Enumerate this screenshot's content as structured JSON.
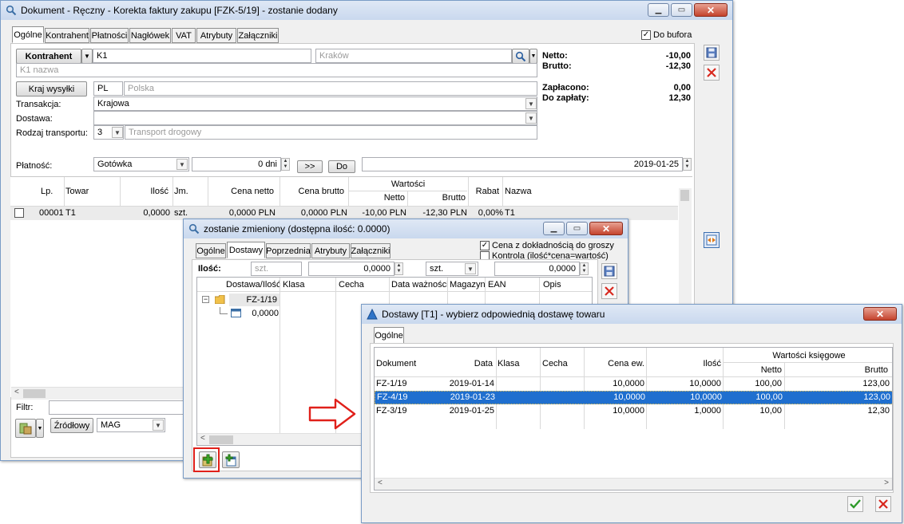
{
  "main": {
    "title": "Dokument - Ręczny - Korekta faktury zakupu [FZK-5/19]  - zostanie dodany",
    "tabs": [
      "Ogólne",
      "Kontrahent",
      "Płatności",
      "Nagłówek",
      "VAT",
      "Atrybuty",
      "Załączniki"
    ],
    "do_bufora": "Do bufora",
    "kontrahent_btn": "Kontrahent",
    "kontrahent_code": "K1",
    "kontrahent_city": "Kraków",
    "kontrahent_name": "K1 nazwa",
    "kraj_btn": "Kraj wysyłki",
    "kraj_code": "PL",
    "kraj_name": "Polska",
    "transakcja_label": "Transakcja:",
    "transakcja_value": "Krajowa",
    "dostawa_label": "Dostawa:",
    "rodzaj_label": "Rodzaj transportu:",
    "rodzaj_code": "3",
    "rodzaj_value": "Transport drogowy",
    "platnosc_label": "Płatność:",
    "platnosc_value": "Gotówka",
    "dni_value": "0 dni",
    "btn_forward": ">>",
    "btn_do": "Do",
    "date_value": "2019-01-25",
    "totals": {
      "netto_label": "Netto:",
      "netto_value": "-10,00",
      "brutto_label": "Brutto:",
      "brutto_value": "-12,30",
      "zaplacono_label": "Zapłacono:",
      "zaplacono_value": "0,00",
      "dozaplaty_label": "Do zapłaty:",
      "dozaplaty_value": "12,30"
    },
    "grid": {
      "headers": {
        "lp": "Lp.",
        "towar": "Towar",
        "ilosc": "Ilość",
        "jm": "Jm.",
        "cena_netto": "Cena netto",
        "cena_brutto": "Cena brutto",
        "wartosci": "Wartości",
        "netto": "Netto",
        "brutto": "Brutto",
        "rabat": "Rabat",
        "nazwa": "Nazwa"
      },
      "row": {
        "lp": "00001",
        "towar": "T1",
        "ilosc": "0,0000",
        "jm": "szt.",
        "cena_netto": "0,0000 PLN",
        "cena_brutto": "0,0000 PLN",
        "netto": "-10,00 PLN",
        "brutto": "-12,30 PLN",
        "rabat": "0,00%",
        "nazwa": "T1"
      }
    },
    "filtr_label": "Filtr:",
    "zrodlowy_btn": "Źródłowy",
    "mag_value": "MAG"
  },
  "second": {
    "title": "zostanie zmieniony (dostępna ilość: 0.0000)",
    "tabs": [
      "Ogólne",
      "Dostawy",
      "Poprzednia",
      "Atrybuty",
      "Załączniki"
    ],
    "chk1": "Cena z dokładnością do groszy",
    "chk2": "Kontrola (ilość*cena=wartość)",
    "ilosc_label": "Ilość:",
    "ilosc_unit": "szt.",
    "ilosc_value": "0,0000",
    "unit_select": "szt.",
    "value2": "0,0000",
    "headers": [
      "Dostawa/Ilość",
      "Klasa",
      "Cecha",
      "Data ważności",
      "Magazyn",
      "EAN",
      "Opis"
    ],
    "tree_parent": "FZ-1/19",
    "tree_child": "0,0000"
  },
  "third": {
    "title": "Dostawy [T1] - wybierz odpowiednią dostawę towaru",
    "tab": "Ogólne",
    "headers": {
      "dokument": "Dokument",
      "data": "Data",
      "klasa": "Klasa",
      "cecha": "Cecha",
      "cena": "Cena ew.",
      "ilosc": "Ilość",
      "wartosci": "Wartości księgowe",
      "netto": "Netto",
      "brutto": "Brutto"
    },
    "rows": [
      {
        "dokument": "FZ-1/19",
        "data": "2019-01-14",
        "cena": "10,0000",
        "ilosc": "10,0000",
        "netto": "100,00",
        "brutto": "123,00"
      },
      {
        "dokument": "FZ-4/19",
        "data": "2019-01-23",
        "cena": "10,0000",
        "ilosc": "10,0000",
        "netto": "100,00",
        "brutto": "123,00"
      },
      {
        "dokument": "FZ-3/19",
        "data": "2019-01-25",
        "cena": "10,0000",
        "ilosc": "1,0000",
        "netto": "10,00",
        "brutto": "12,30"
      }
    ]
  },
  "colors": {
    "selection": "#1f6fcf",
    "arrow": "#e0201a",
    "highlight": "#e0201a"
  }
}
